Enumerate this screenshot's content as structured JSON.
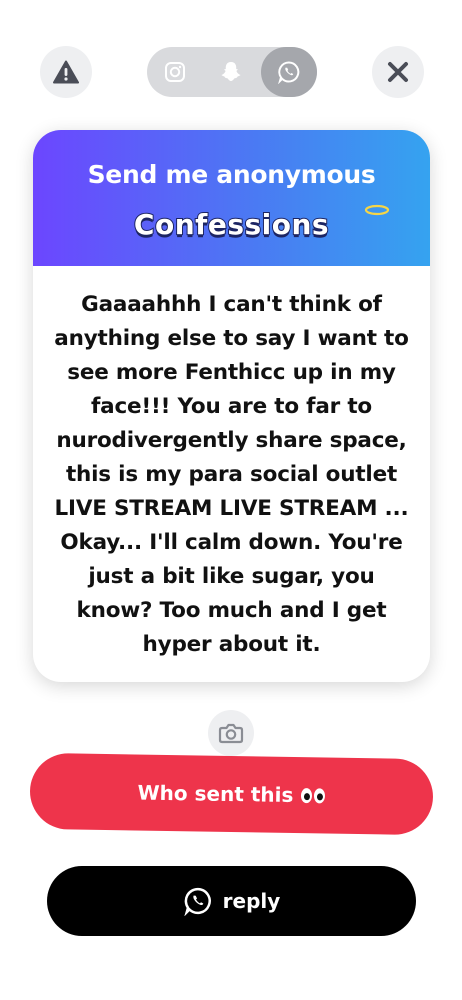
{
  "top_bar": {
    "warn_icon": "warning-triangle-icon",
    "close_icon": "close-x-icon",
    "share_options": [
      {
        "icon": "instagram-icon",
        "active": false
      },
      {
        "icon": "snapchat-icon",
        "active": false
      },
      {
        "icon": "whatsapp-icon",
        "active": true
      }
    ]
  },
  "card": {
    "header_title": "Send me anonymous",
    "header_logo_text": "Confessions",
    "message": "Gaaaahhh I can't think of anything else to say I want to see more Fenthicc up in my face!!! You are to far to nurodivergently share space, this is my para social outlet LIVE STREAM LIVE STREAM ... Okay... I'll calm down. You're just a bit like sugar, you know? Too much and I get hyper about it."
  },
  "actions": {
    "camera_icon": "camera-icon",
    "who_sent_label": "Who sent this",
    "reply_label": "reply"
  },
  "colors": {
    "header_gradient_start": "#6c46ff",
    "header_gradient_end": "#35a3f0",
    "who_button": "#ee344b",
    "reply_button": "#000000"
  }
}
